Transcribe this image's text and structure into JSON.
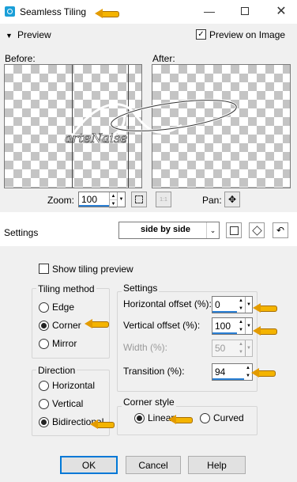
{
  "window": {
    "title": "Seamless Tiling"
  },
  "preview": {
    "header": "Preview",
    "preview_on_image": "Preview on Image",
    "before_label": "Before:",
    "after_label": "After:",
    "zoom_label": "Zoom:",
    "zoom_value": "100",
    "pan_label": "Pan:",
    "watermark": "arteNaise"
  },
  "settings": {
    "label": "Settings",
    "preset": "side by side"
  },
  "options": {
    "show_tiling_preview": "Show tiling preview",
    "tiling_method": {
      "title": "Tiling method",
      "items": [
        "Edge",
        "Corner",
        "Mirror"
      ],
      "selected": "Corner"
    },
    "direction": {
      "title": "Direction",
      "items": [
        "Horizontal",
        "Vertical",
        "Bidirectional"
      ],
      "selected": "Bidirectional"
    },
    "settings_group": {
      "title": "Settings",
      "horizontal_offset_label": "Horizontal offset (%):",
      "horizontal_offset": "0",
      "vertical_offset_label": "Vertical offset (%):",
      "vertical_offset": "100",
      "width_label": "Width (%):",
      "width": "50",
      "transition_label": "Transition (%):",
      "transition": "94"
    },
    "corner_style": {
      "title": "Corner style",
      "items": [
        "Linear",
        "Curved"
      ],
      "selected": "Linear"
    }
  },
  "buttons": {
    "ok": "OK",
    "cancel": "Cancel",
    "help": "Help"
  },
  "colors": {
    "accent": "#0078d7",
    "arrow": "#f4b400",
    "panel": "#f0f0f0"
  }
}
